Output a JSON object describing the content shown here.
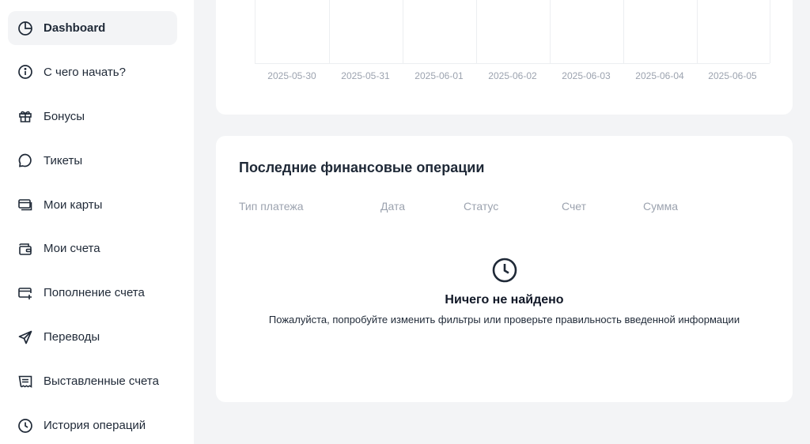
{
  "sidebar": {
    "items": [
      {
        "label": "Dashboard",
        "icon": "pie-chart-icon",
        "active": true
      },
      {
        "label": "С чего начать?",
        "icon": "info-icon"
      },
      {
        "label": "Бонусы",
        "icon": "gift-icon"
      },
      {
        "label": "Тикеты",
        "icon": "chat-bubble-icon"
      },
      {
        "label": "Мои карты",
        "icon": "cards-icon"
      },
      {
        "label": "Мои счета",
        "icon": "wallet-icon"
      },
      {
        "label": "Пополнение счета",
        "icon": "card-add-icon"
      },
      {
        "label": "Переводы",
        "icon": "send-icon"
      },
      {
        "label": "Выставленные счета",
        "icon": "receipt-icon"
      },
      {
        "label": "История операций",
        "icon": "clock-icon"
      }
    ]
  },
  "chart": {
    "dates": [
      "2025-05-30",
      "2025-05-31",
      "2025-06-01",
      "2025-06-02",
      "2025-06-03",
      "2025-06-04",
      "2025-06-05"
    ]
  },
  "operations": {
    "title": "Последние финансовые операции",
    "columns": [
      "Тип платежа",
      "Дата",
      "Статус",
      "Счет",
      "Сумма"
    ],
    "empty": {
      "icon": "clock-icon",
      "title": "Ничего не найдено",
      "text": "Пожалуйста, попробуйте изменить фильтры или проверьте правильность введенной информации"
    }
  }
}
